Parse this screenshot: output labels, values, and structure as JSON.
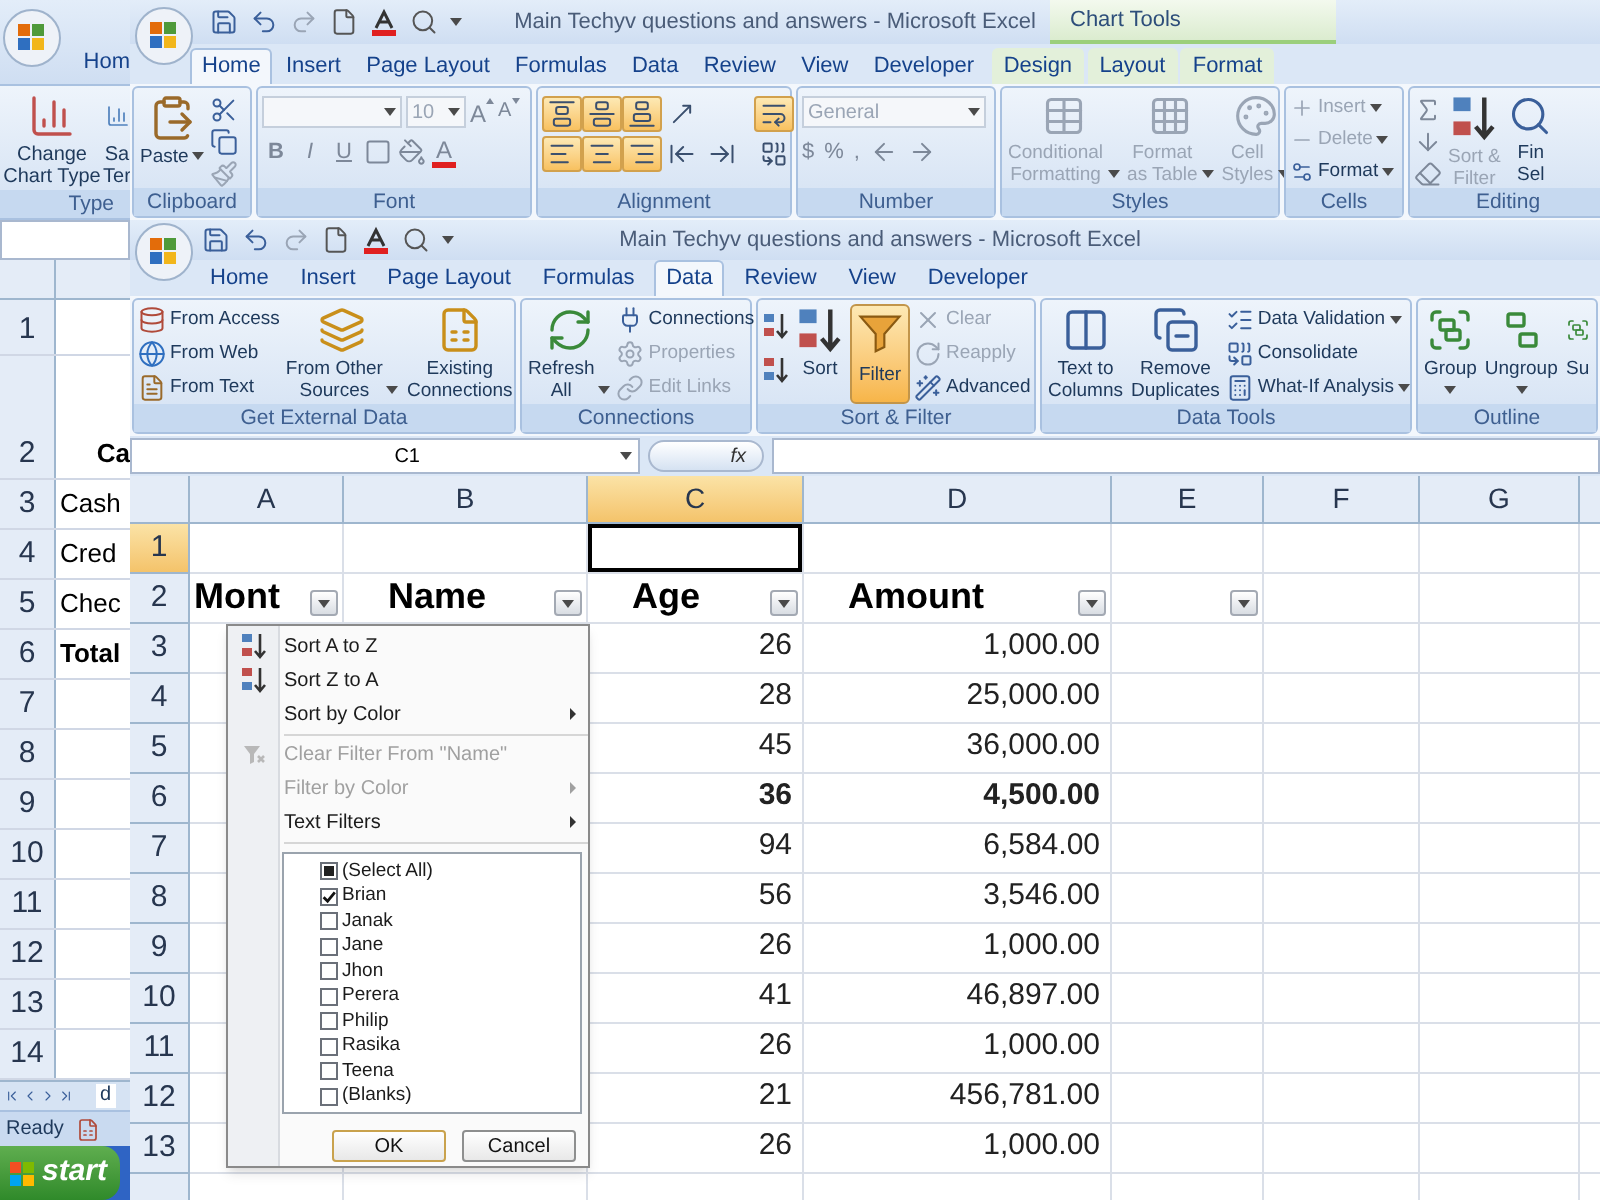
{
  "back_window": {
    "tab": "Hom",
    "buttons": [
      {
        "lines": [
          "Change",
          "Chart Type"
        ]
      },
      {
        "lines": [
          "Sa",
          "Ter"
        ]
      }
    ],
    "group": "Type",
    "rows": [
      {
        "label": "1"
      },
      {
        "label": "2",
        "cell": "Ca",
        "bold": true
      },
      {
        "label": "3",
        "cell": "Cash",
        "bold": false
      },
      {
        "label": "4",
        "cell": "Cred",
        "bold": false
      },
      {
        "label": "5",
        "cell": "Chec",
        "bold": false
      },
      {
        "label": "6",
        "cell": "Total",
        "bold": true
      },
      {
        "label": "7"
      },
      {
        "label": "8"
      },
      {
        "label": "9"
      },
      {
        "label": "10"
      },
      {
        "label": "11"
      },
      {
        "label": "12"
      },
      {
        "label": "13"
      },
      {
        "label": "14"
      }
    ],
    "sheet_tab": "d",
    "status": "Ready"
  },
  "home_window": {
    "title": "Main Techyv questions and answers - Microsoft Excel",
    "context": "Chart Tools",
    "tabs": [
      {
        "label": "Home",
        "selected": true,
        "contextual": false
      },
      {
        "label": "Insert",
        "selected": false,
        "contextual": false
      },
      {
        "label": "Page Layout",
        "selected": false,
        "contextual": false
      },
      {
        "label": "Formulas",
        "selected": false,
        "contextual": false
      },
      {
        "label": "Data",
        "selected": false,
        "contextual": false
      },
      {
        "label": "Review",
        "selected": false,
        "contextual": false
      },
      {
        "label": "View",
        "selected": false,
        "contextual": false
      },
      {
        "label": "Developer",
        "selected": false,
        "contextual": false
      },
      {
        "label": "Design",
        "selected": false,
        "contextual": true
      },
      {
        "label": "Layout",
        "selected": false,
        "contextual": true
      },
      {
        "label": "Format",
        "selected": false,
        "contextual": true
      }
    ],
    "clipboard": {
      "label": "Clipboard",
      "paste": "Paste"
    },
    "font": {
      "label": "Font",
      "size": "10",
      "size_buttons": [
        "A",
        "A"
      ],
      "styles": [
        "B",
        "I",
        "U"
      ],
      "color_button": "A"
    },
    "alignment": {
      "label": "Alignment",
      "buttons": [
        {
          "highlighted": true
        },
        {
          "highlighted": true
        },
        {
          "highlighted": true
        },
        {
          "highlighted": false
        },
        {
          "highlighted": true
        },
        {
          "highlighted": true
        },
        {
          "highlighted": true
        },
        {
          "highlighted": false
        },
        {
          "highlighted": false
        },
        {
          "highlighted": true
        },
        {
          "highlighted": false
        }
      ]
    },
    "number": {
      "label": "Number",
      "format": "General",
      "symbols": [
        "$",
        "%",
        ","
      ]
    },
    "styles": {
      "label": "Styles",
      "buttons": [
        {
          "lines": [
            "Conditional",
            "Formatting"
          ],
          "disabled": true
        },
        {
          "lines": [
            "Format",
            "as Table"
          ],
          "disabled": true
        },
        {
          "lines": [
            "Cell",
            "Styles"
          ],
          "disabled": true
        }
      ]
    },
    "cells": {
      "label": "Cells",
      "buttons": [
        {
          "label": "Insert",
          "disabled": true
        },
        {
          "label": "Delete",
          "disabled": true
        },
        {
          "label": "Format",
          "disabled": false
        }
      ]
    },
    "editing": {
      "label": "Editing",
      "buttons": [
        {
          "lines": [
            "Sort &",
            "Filter"
          ],
          "disabled": true
        },
        {
          "lines": [
            "Fin",
            "Sel"
          ],
          "disabled": false
        }
      ]
    }
  },
  "data_window": {
    "title": "Main Techyv questions and answers - Microsoft Excel",
    "tabs": [
      {
        "label": "Home",
        "selected": false
      },
      {
        "label": "Insert",
        "selected": false
      },
      {
        "label": "Page Layout",
        "selected": false
      },
      {
        "label": "Formulas",
        "selected": false
      },
      {
        "label": "Data",
        "selected": true
      },
      {
        "label": "Review",
        "selected": false
      },
      {
        "label": "View",
        "selected": false
      },
      {
        "label": "Developer",
        "selected": false
      }
    ],
    "get_external_data": {
      "label": "Get External Data",
      "small": [
        "From Access",
        "From Web",
        "From Text"
      ],
      "large": [
        {
          "lines": [
            "From Other",
            "Sources"
          ]
        },
        {
          "lines": [
            "Existing",
            "Connections"
          ]
        }
      ]
    },
    "connections": {
      "label": "Connections",
      "refresh": [
        "Refresh",
        "All"
      ],
      "small": [
        {
          "label": "Connections",
          "disabled": false
        },
        {
          "label": "Properties",
          "disabled": true
        },
        {
          "label": "Edit Links",
          "disabled": true
        }
      ]
    },
    "sort_filter": {
      "label": "Sort & Filter",
      "sort": "Sort",
      "filter": {
        "label": "Filter",
        "selected": true
      },
      "small": [
        {
          "label": "Clear",
          "disabled": true
        },
        {
          "label": "Reapply",
          "disabled": true
        },
        {
          "label": "Advanced",
          "disabled": false
        }
      ]
    },
    "data_tools": {
      "label": "Data Tools",
      "large": [
        {
          "lines": [
            "Text to",
            "Columns"
          ]
        },
        {
          "lines": [
            "Remove",
            "Duplicates"
          ]
        }
      ],
      "small": [
        "Data Validation",
        "Consolidate",
        "What-If Analysis"
      ]
    },
    "outline": {
      "label": "Outline",
      "large": [
        "Group",
        "Ungroup",
        "Su"
      ]
    }
  },
  "sheet": {
    "name_box": "C1",
    "formula_button": "fx",
    "columns": [
      {
        "label": "A",
        "selected": false
      },
      {
        "label": "B",
        "selected": false
      },
      {
        "label": "C",
        "selected": true
      },
      {
        "label": "D",
        "selected": false
      },
      {
        "label": "E",
        "selected": false
      },
      {
        "label": "F",
        "selected": false
      },
      {
        "label": "G",
        "selected": false
      }
    ],
    "rows": [
      {
        "label": "1",
        "selected": true
      },
      {
        "label": "2",
        "selected": false
      },
      {
        "label": "3",
        "selected": false
      },
      {
        "label": "4",
        "selected": false
      },
      {
        "label": "5",
        "selected": false
      },
      {
        "label": "6",
        "selected": false
      },
      {
        "label": "7",
        "selected": false
      },
      {
        "label": "8",
        "selected": false
      },
      {
        "label": "9",
        "selected": false
      },
      {
        "label": "10",
        "selected": false
      },
      {
        "label": "11",
        "selected": false
      },
      {
        "label": "12",
        "selected": false
      },
      {
        "label": "13",
        "selected": false
      }
    ],
    "headers": [
      {
        "text": "Mont",
        "filter": true
      },
      {
        "text": "Name",
        "filter": true
      },
      {
        "text": "Age",
        "filter": true
      },
      {
        "text": "Amount",
        "filter": true
      },
      {
        "filter": true
      }
    ],
    "data": [
      {
        "age": "26",
        "amount": "1,000.00",
        "bold": false
      },
      {
        "age": "28",
        "amount": "25,000.00",
        "bold": false
      },
      {
        "age": "45",
        "amount": "36,000.00",
        "bold": false
      },
      {
        "age": "36",
        "amount": "4,500.00",
        "bold": true
      },
      {
        "age": "94",
        "amount": "6,584.00",
        "bold": false
      },
      {
        "age": "56",
        "amount": "3,546.00",
        "bold": false
      },
      {
        "age": "26",
        "amount": "1,000.00",
        "bold": false
      },
      {
        "age": "41",
        "amount": "46,897.00",
        "bold": false
      },
      {
        "age": "26",
        "amount": "1,000.00",
        "bold": false
      },
      {
        "age": "21",
        "amount": "456,781.00",
        "bold": false
      },
      {
        "age": "26",
        "amount": "1,000.00",
        "bold": false
      }
    ]
  },
  "filter_menu": {
    "sort_items": [
      {
        "label": "Sort A to Z",
        "disabled": false,
        "submenu": false
      },
      {
        "label": "Sort Z to A",
        "disabled": false,
        "submenu": false
      },
      {
        "label": "Sort by Color",
        "disabled": false,
        "submenu": true
      }
    ],
    "filter_items": [
      {
        "label": "Clear Filter From \"Name\"",
        "disabled": true,
        "submenu": false
      },
      {
        "label": "Filter by Color",
        "disabled": true,
        "submenu": true
      },
      {
        "label": "Text Filters",
        "disabled": false,
        "submenu": true
      }
    ],
    "values": [
      {
        "label": "(Select All)",
        "checked": false,
        "mixed": true
      },
      {
        "label": "Brian",
        "checked": true,
        "mixed": false
      },
      {
        "label": "Janak",
        "checked": false,
        "mixed": false
      },
      {
        "label": "Jane",
        "checked": false,
        "mixed": false
      },
      {
        "label": "Jhon",
        "checked": false,
        "mixed": false
      },
      {
        "label": "Perera",
        "checked": false,
        "mixed": false
      },
      {
        "label": "Philip",
        "checked": false,
        "mixed": false
      },
      {
        "label": "Rasika",
        "checked": false,
        "mixed": false
      },
      {
        "label": "Teena",
        "checked": false,
        "mixed": false
      },
      {
        "label": "(Blanks)",
        "checked": false,
        "mixed": false
      }
    ],
    "buttons": [
      "OK",
      "Cancel"
    ]
  },
  "taskbar": {
    "start": "start"
  }
}
